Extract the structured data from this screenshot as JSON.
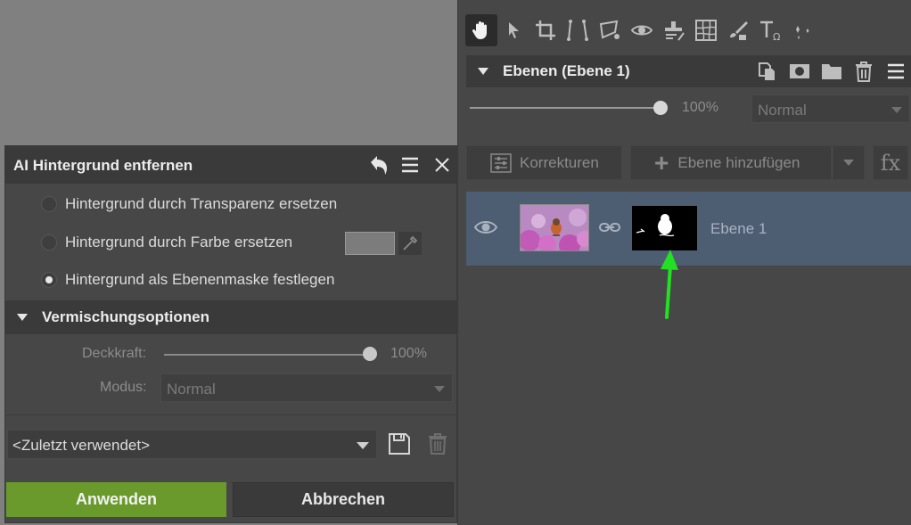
{
  "toolbar": {
    "tools": [
      "hand-icon",
      "pointer-icon",
      "crop-icon",
      "perspective-icon",
      "selection-icon",
      "eye-icon",
      "clone-stamp-icon",
      "grid-icon",
      "brush-eraser-icon",
      "text-icon",
      "effects-icon"
    ],
    "active_tool": "hand-icon"
  },
  "layers_panel": {
    "title": "Ebenen (Ebene 1)",
    "opacity": "100%",
    "blend_mode": "Normal",
    "corrections_button": "Korrekturen",
    "add_layer_button": "Ebene hinzufügen",
    "fx_button": "fx",
    "layers": [
      {
        "name": "Ebene 1",
        "selected": true,
        "visible": true
      }
    ]
  },
  "dialog": {
    "title": "AI Hintergrund entfernen",
    "options": [
      {
        "label": "Hintergrund durch Transparenz ersetzen",
        "checked": false
      },
      {
        "label": "Hintergrund durch Farbe ersetzen",
        "checked": false
      },
      {
        "label": "Hintergrund als Ebenenmaske festlegen",
        "checked": true
      }
    ],
    "swatch_color": "#7c7c7c",
    "blend_section_title": "Vermischungsoptionen",
    "opacity_label": "Deckkraft:",
    "opacity_value": "100%",
    "mode_label": "Modus:",
    "mode_value": "Normal",
    "preset_value": "<Zuletzt verwendet>",
    "apply_button": "Anwenden",
    "cancel_button": "Abbrechen"
  },
  "colors": {
    "accent_green": "#6a9a2c",
    "selected_layer": "#4d5d72",
    "annotation_arrow": "#22e022"
  }
}
